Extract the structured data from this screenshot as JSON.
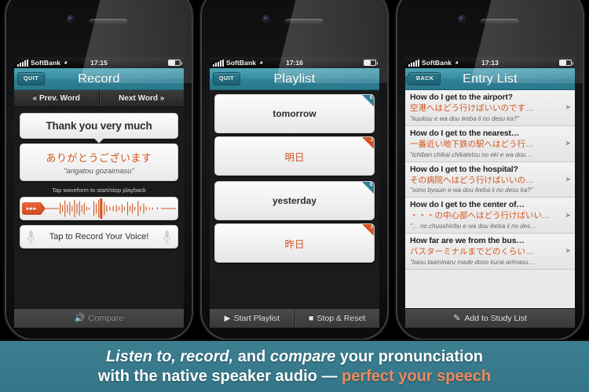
{
  "phones": [
    {
      "id": "record",
      "status": {
        "carrier": "SoftBank",
        "wifi": "wifi-icon",
        "time": "17:15"
      },
      "nav": {
        "button": "QUIT",
        "title": "Record"
      },
      "wordnav": {
        "prev": "« Prev. Word",
        "next": "Next Word »"
      },
      "phrase": {
        "english": "Thank you very much",
        "japanese": "ありがとうございます",
        "romaji": "\"arigatou gozaimasu\""
      },
      "hint": "Tap waveform to start/stop playback",
      "record_label": "Tap to Record Your Voice!",
      "compare_label": "Compare"
    },
    {
      "id": "playlist",
      "status": {
        "carrier": "SoftBank",
        "wifi": "wifi-icon",
        "time": "17:16"
      },
      "nav": {
        "button": "QUIT",
        "title": "Playlist"
      },
      "groups": [
        {
          "en_text": "tomorrow",
          "en_badge": "E",
          "jp_text": "明日",
          "jp_badge": "J"
        },
        {
          "en_text": "yesterday",
          "en_badge": "E",
          "jp_text": "昨日",
          "jp_badge": "J"
        }
      ],
      "controls": {
        "start": "Start Playlist",
        "stop": "Stop & Reset"
      }
    },
    {
      "id": "entrylist",
      "status": {
        "carrier": "SoftBank",
        "wifi": "wifi-icon",
        "time": "17:13"
      },
      "nav": {
        "button": "BACK",
        "title": "Entry List"
      },
      "entries": [
        {
          "english": "How do I get to the airport?",
          "japanese": "空港へはどう行けばいいのです…",
          "romaji": "\"kuukou e wa dou ikeba ii no desu ka?\""
        },
        {
          "english": "How do I get to the nearest…",
          "japanese": "一番近い地下鉄の駅へはどう行…",
          "romaji": "\"ichiban chikai chikatetsu no eki e wa dou…"
        },
        {
          "english": "How do I get to the hospital?",
          "japanese": "その病院へはどう行けばいいの…",
          "romaji": "\"sono byouin e wa dou ikeba ii no desu ka?\""
        },
        {
          "english": "How do I get to the center of…",
          "japanese": "・・・の中心部へはどう行けばいい…",
          "romaji": "\"… no chuushinbu e wa dou ikeba ii no des…"
        },
        {
          "english": "How far are we from the bus…",
          "japanese": "バスターミナルまでどのくらい…",
          "romaji": "\"basu taaminaru made dono kurai arimasu…"
        }
      ],
      "study_label": "Add to Study List"
    }
  ],
  "caption": {
    "line1_a": "Listen to, record,",
    "line1_b": " and ",
    "line1_c": "compare",
    "line1_d": " your pronunciation",
    "line2_a": "with the native speaker audio — ",
    "line2_accent": "perfect your speech"
  },
  "colors": {
    "teal_nav": "#2f8196",
    "teal_banner": "#3c7f90",
    "orange": "#d2541f",
    "accent_orange": "#f08a5d"
  }
}
